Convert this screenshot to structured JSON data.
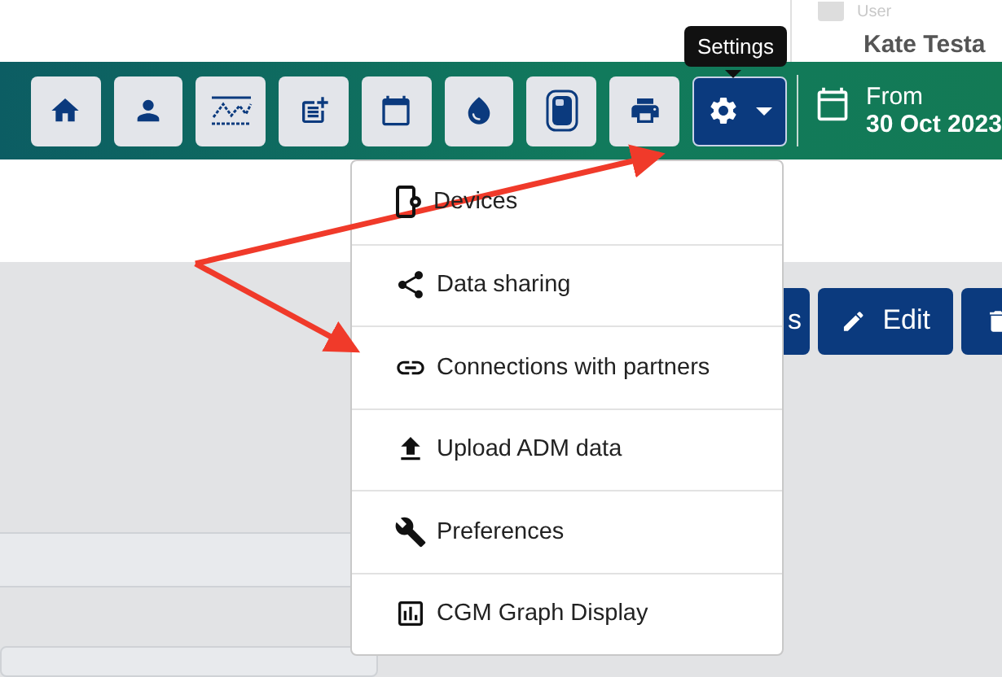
{
  "user": {
    "label": "User",
    "name": "Kate Testa"
  },
  "toolbar": {
    "buttons": [
      {
        "kind": "home",
        "selected": false
      },
      {
        "kind": "person",
        "selected": false
      },
      {
        "kind": "graph",
        "selected": false
      },
      {
        "kind": "note",
        "selected": false
      },
      {
        "kind": "calendar",
        "selected": false
      },
      {
        "kind": "drop",
        "selected": false
      },
      {
        "kind": "device",
        "selected": false
      },
      {
        "kind": "print",
        "selected": false
      },
      {
        "kind": "settings",
        "selected": true,
        "dropdown": true
      }
    ],
    "tooltip": "Settings",
    "date": {
      "label": "From",
      "value": "30 Oct 2023"
    }
  },
  "actions": [
    {
      "kind": "text",
      "label": "s"
    },
    {
      "kind": "edit",
      "label": "Edit"
    },
    {
      "kind": "delete"
    }
  ],
  "menu": {
    "items": [
      {
        "kind": "devices",
        "label": "Devices"
      },
      {
        "kind": "share",
        "label": "Data sharing"
      },
      {
        "kind": "link",
        "label": "Connections with partners"
      },
      {
        "kind": "upload",
        "label": "Upload ADM data"
      },
      {
        "kind": "wrench",
        "label": "Preferences"
      },
      {
        "kind": "chart",
        "label": "CGM Graph Display"
      }
    ]
  }
}
